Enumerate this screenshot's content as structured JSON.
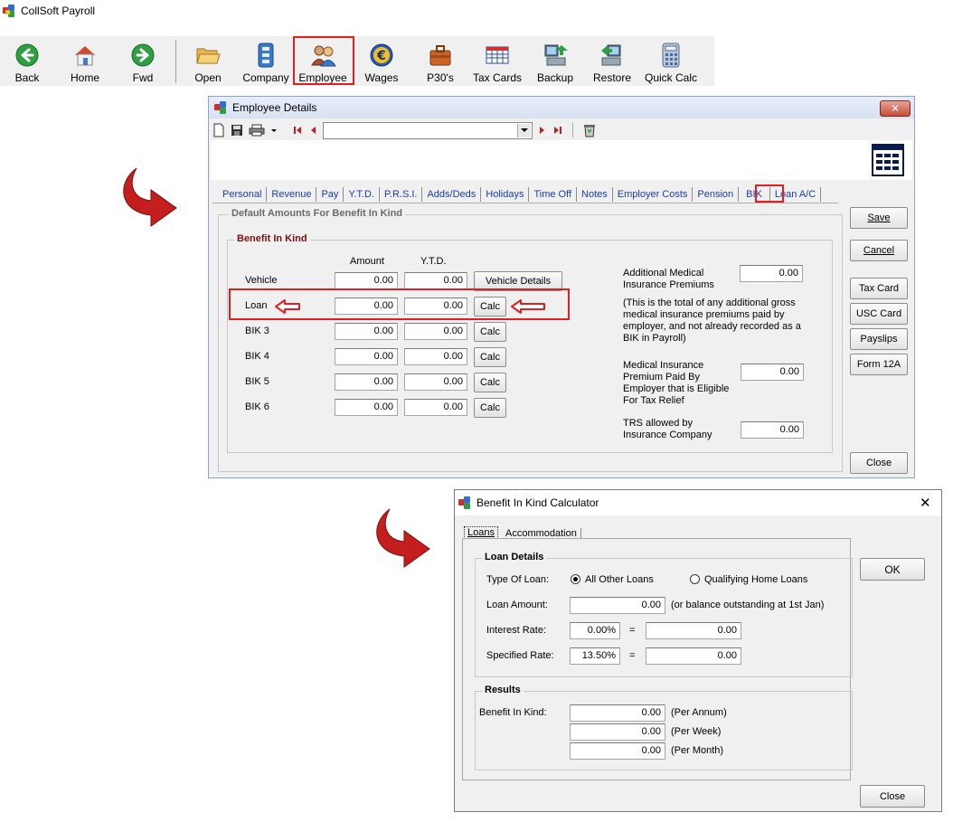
{
  "app": {
    "title": "CollSoft Payroll"
  },
  "toolbar": {
    "buttons": [
      {
        "label": "Back",
        "icon": "back-arrow-icon"
      },
      {
        "label": "Home",
        "icon": "home-icon"
      },
      {
        "label": "Fwd",
        "icon": "forward-arrow-icon"
      },
      {
        "label": "Open",
        "icon": "folder-icon"
      },
      {
        "label": "Company",
        "icon": "company-building-icon"
      },
      {
        "label": "Employee",
        "icon": "employees-icon"
      },
      {
        "label": "Wages",
        "icon": "euro-coin-icon"
      },
      {
        "label": "P30's",
        "icon": "briefcase-icon"
      },
      {
        "label": "Tax Cards",
        "icon": "tax-cards-grid-icon"
      },
      {
        "label": "Backup",
        "icon": "backup-computer-icon"
      },
      {
        "label": "Restore",
        "icon": "restore-computer-icon"
      },
      {
        "label": "Quick Calc",
        "icon": "calculator-icon"
      }
    ]
  },
  "employee_window": {
    "title": "Employee Details",
    "close_glyph": "✕",
    "tabs": [
      "Personal",
      "Revenue",
      "Pay",
      "Y.T.D.",
      "P.R.S.I.",
      "Adds/Deds",
      "Holidays",
      "Time Off",
      "Notes",
      "Employer Costs",
      "Pension",
      "BIK",
      "Loan A/C"
    ],
    "active_tab": "BIK",
    "outer_group": "Default Amounts For Benefit In Kind",
    "inner_group": "Benefit In Kind",
    "col_amount": "Amount",
    "col_ytd": "Y.T.D.",
    "rows": [
      {
        "label": "Vehicle",
        "amount": "0.00",
        "ytd": "0.00",
        "button": "Vehicle Details"
      },
      {
        "label": "Loan",
        "amount": "0.00",
        "ytd": "0.00",
        "button": "Calc"
      },
      {
        "label": "BIK 3",
        "amount": "0.00",
        "ytd": "0.00",
        "button": "Calc"
      },
      {
        "label": "BIK 4",
        "amount": "0.00",
        "ytd": "0.00",
        "button": "Calc"
      },
      {
        "label": "BIK 5",
        "amount": "0.00",
        "ytd": "0.00",
        "button": "Calc"
      },
      {
        "label": "BIK 6",
        "amount": "0.00",
        "ytd": "0.00",
        "button": "Calc"
      }
    ],
    "additional_medical_label_1": "Additional Medical",
    "additional_medical_label_2": "Insurance Premiums",
    "additional_medical_value": "0.00",
    "medical_note_1": "(This is the total of any additional gross",
    "medical_note_2": "medical insurance premiums paid by",
    "medical_note_3": "employer, and not already recorded as a",
    "medical_note_4": "BIK in Payroll)",
    "medical_premium_label_1": "Medical Insurance",
    "medical_premium_label_2": "Premium Paid By",
    "medical_premium_label_3": "Employer that is Eligible",
    "medical_premium_label_4": "For Tax Relief",
    "medical_premium_value": "0.00",
    "trs_label_1": "TRS allowed by",
    "trs_label_2": "Insurance Company",
    "trs_value": "0.00",
    "side_buttons": {
      "save": "Save",
      "cancel": "Cancel",
      "tax_card": "Tax Card",
      "usc_card": "USC Card",
      "payslips": "Payslips",
      "form12a": "Form 12A",
      "close": "Close"
    }
  },
  "bik_window": {
    "title": "Benefit In Kind Calculator",
    "close_glyph": "✕",
    "tabs": [
      "Loans",
      "Accommodation"
    ],
    "loan_details_caption": "Loan Details",
    "type_of_loan_label": "Type Of Loan:",
    "option_other": "All Other Loans",
    "option_home": "Qualifying Home Loans",
    "loan_amount_label": "Loan Amount:",
    "loan_amount_value": "0.00",
    "loan_amount_note": "(or balance outstanding at 1st Jan)",
    "interest_rate_label": "Interest Rate:",
    "interest_rate_value": "0.00%",
    "interest_result": "0.00",
    "specified_rate_label": "Specified Rate:",
    "specified_rate_value": "13.50%",
    "specified_result": "0.00",
    "equals": "=",
    "results_caption": "Results",
    "bik_label": "Benefit In Kind:",
    "per_annum_value": "0.00",
    "per_annum_label": "(Per Annum)",
    "per_week_value": "0.00",
    "per_week_label": "(Per Week)",
    "per_month_value": "0.00",
    "per_month_label": "(Per Month)",
    "ok": "OK",
    "close": "Close"
  },
  "colors": {
    "highlight": "#e02020",
    "tab_link": "#1a3da8",
    "arrow_red": "#c41e1e"
  }
}
